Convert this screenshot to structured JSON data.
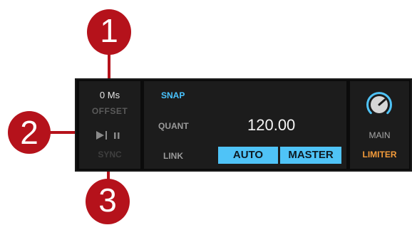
{
  "deck_controls": {
    "offset_value": "0 Ms",
    "offset_label": "OFFSET",
    "sync_label": "SYNC"
  },
  "tempo": {
    "snap_label": "SNAP",
    "quant_label": "QUANT",
    "bpm_value": "120.00",
    "link_label": "LINK",
    "auto_label": "AUTO",
    "master_label": "MASTER"
  },
  "output": {
    "main_label": "MAIN",
    "limiter_label": "LIMITER"
  },
  "callouts": [
    "1",
    "2",
    "3"
  ],
  "icons": {
    "transport": "play-pause-icon",
    "main_knob": "volume-knob-icon"
  },
  "colors": {
    "accent_blue": "#49c4ff",
    "button_blue": "#4fc3f7",
    "limiter_orange": "#f39b3a",
    "callout_red": "#b5121b",
    "panel_bg": "#1c1c1c"
  }
}
